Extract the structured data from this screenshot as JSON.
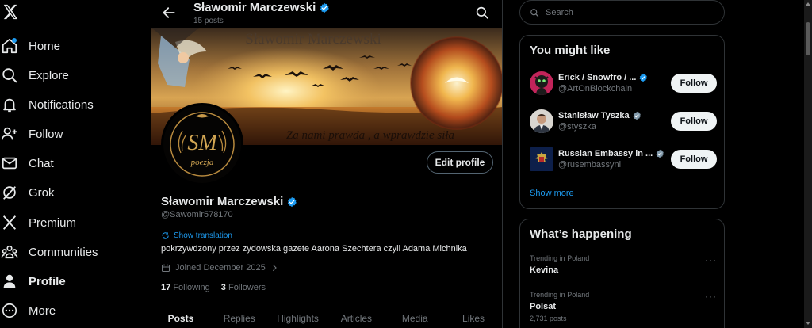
{
  "nav": {
    "items": [
      {
        "key": "home",
        "label": "Home",
        "icon": "home-icon"
      },
      {
        "key": "explore",
        "label": "Explore",
        "icon": "search-icon"
      },
      {
        "key": "notifications",
        "label": "Notifications",
        "icon": "bell-icon"
      },
      {
        "key": "follow",
        "label": "Follow",
        "icon": "add-person-icon"
      },
      {
        "key": "chat",
        "label": "Chat",
        "icon": "mail-icon"
      },
      {
        "key": "grok",
        "label": "Grok",
        "icon": "grok-icon"
      },
      {
        "key": "premium",
        "label": "Premium",
        "icon": "x-icon"
      },
      {
        "key": "communities",
        "label": "Communities",
        "icon": "people-icon"
      },
      {
        "key": "profile",
        "label": "Profile",
        "icon": "person-icon",
        "active": true
      },
      {
        "key": "more",
        "label": "More",
        "icon": "more-circle-icon"
      }
    ]
  },
  "header": {
    "name": "Sławomir Marczewski",
    "posts": "15 posts"
  },
  "banner": {
    "title": "Sławomir Marczewski",
    "motto": "Za nami prawda , a wprawdzie siła"
  },
  "avatar": {
    "initials": "SM",
    "word": "poezja"
  },
  "profile": {
    "edit_label": "Edit profile",
    "name": "Sławomir Marczewski",
    "handle": "@Sawomir578170",
    "translate": "Show translation",
    "bio": "pokrzywdzony przez zydowska gazete Aarona Szechtera czyli Adama Michnika",
    "joined": "Joined December 2025",
    "following_count": "17",
    "following_label": "Following",
    "followers_count": "3",
    "followers_label": "Followers"
  },
  "tabs": [
    "Posts",
    "Replies",
    "Highlights",
    "Articles",
    "Media",
    "Likes"
  ],
  "search": {
    "placeholder": "Search"
  },
  "suggestions": {
    "title": "You might like",
    "show_more": "Show more",
    "items": [
      {
        "name": "Erick / Snowfro / ...",
        "handle": "@ArtOnBlockchain",
        "verified": "blue",
        "button": "Follow"
      },
      {
        "name": "Stanisław Tyszka",
        "handle": "@styszka",
        "verified": "grey",
        "button": "Follow"
      },
      {
        "name": "Russian Embassy in ...",
        "handle": "@rusembassynl",
        "verified": "grey",
        "button": "Follow"
      }
    ]
  },
  "trends": {
    "title": "What’s happening",
    "items": [
      {
        "context": "Trending in Poland",
        "topic": "Kevina",
        "count": ""
      },
      {
        "context": "Trending in Poland",
        "topic": "Polsat",
        "count": "2,731 posts"
      }
    ],
    "more_glyph": "···"
  },
  "colors": {
    "background": "#000000",
    "accent": "#1d9bf0",
    "border": "#2f3336",
    "muted": "#71767b",
    "text": "#e7e9ea",
    "verified_grey": "#829aab"
  }
}
